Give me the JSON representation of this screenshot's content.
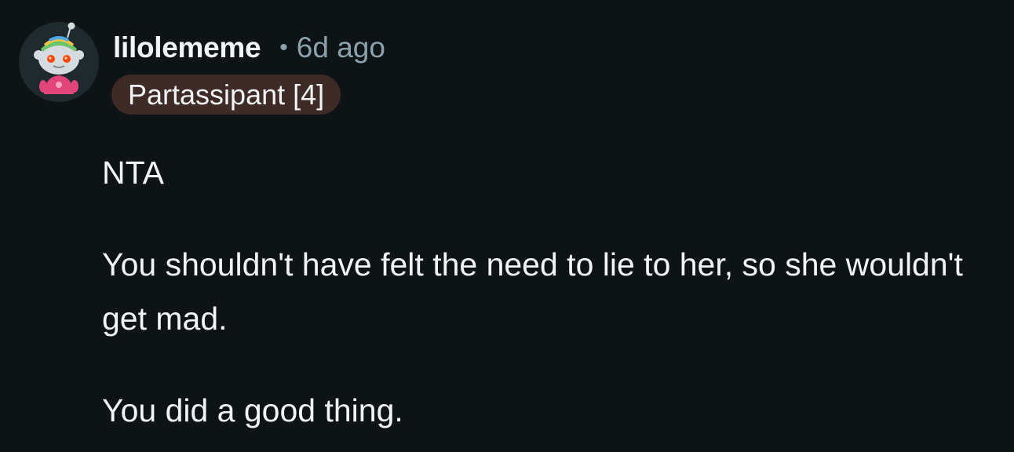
{
  "comment": {
    "author": {
      "username": "lilolememe",
      "avatar_icon": "snoo-avatar-icon",
      "flair": "Partassipant [4]",
      "flair_color": "#3e2b27"
    },
    "separator": "•",
    "timestamp": "6d ago",
    "paragraphs": [
      "NTA",
      "You shouldn't have felt the need to lie to her, so she wouldn't get mad.",
      "You did a good thing."
    ]
  },
  "colors": {
    "background": "#0e1416",
    "text_primary": "#f2f4f5",
    "text_secondary": "#8ba2ad"
  }
}
